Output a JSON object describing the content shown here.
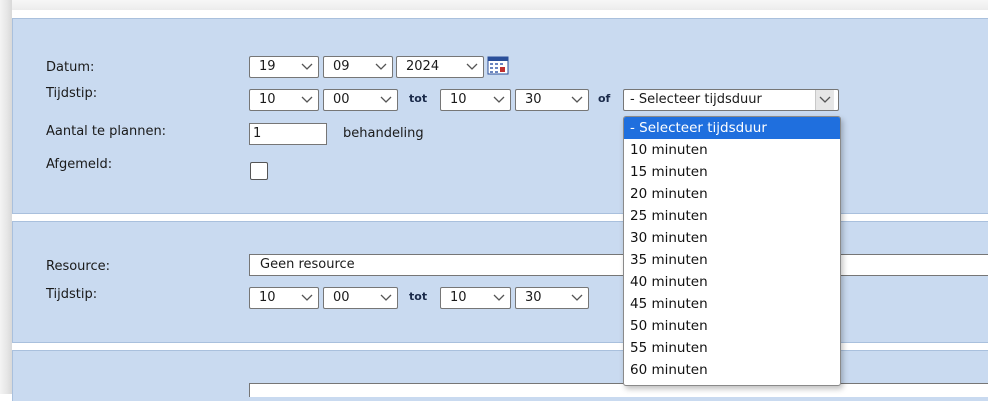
{
  "section1": {
    "datum_label": "Datum:",
    "tijdstip_label": "Tijdstip:",
    "aantal_label": "Aantal te plannen:",
    "afgemeld_label": "Afgemeld:",
    "day": "19",
    "month": "09",
    "year": "2024",
    "start_hour": "10",
    "start_minute": "00",
    "tot": "tot",
    "end_hour": "10",
    "end_minute": "30",
    "of": "of",
    "duration_selected": "- Selecteer tijdsduur",
    "aantal_value": "1",
    "aantal_unit": "behandeling"
  },
  "section2": {
    "resource_label": "Resource:",
    "tijdstip_label": "Tijdstip:",
    "resource_value": "Geen resource",
    "start_hour": "10",
    "start_minute": "00",
    "tot": "tot",
    "end_hour": "10",
    "end_minute": "30"
  },
  "duration_options": [
    "- Selecteer tijdsduur",
    "10 minuten",
    "15 minuten",
    "20 minuten",
    "25 minuten",
    "30 minuten",
    "35 minuten",
    "40 minuten",
    "45 minuten",
    "50 minuten",
    "55 minuten",
    "60 minuten"
  ],
  "colors": {
    "panel_bg": "#c9daf0",
    "selected_option_bg": "#1f6fde"
  }
}
